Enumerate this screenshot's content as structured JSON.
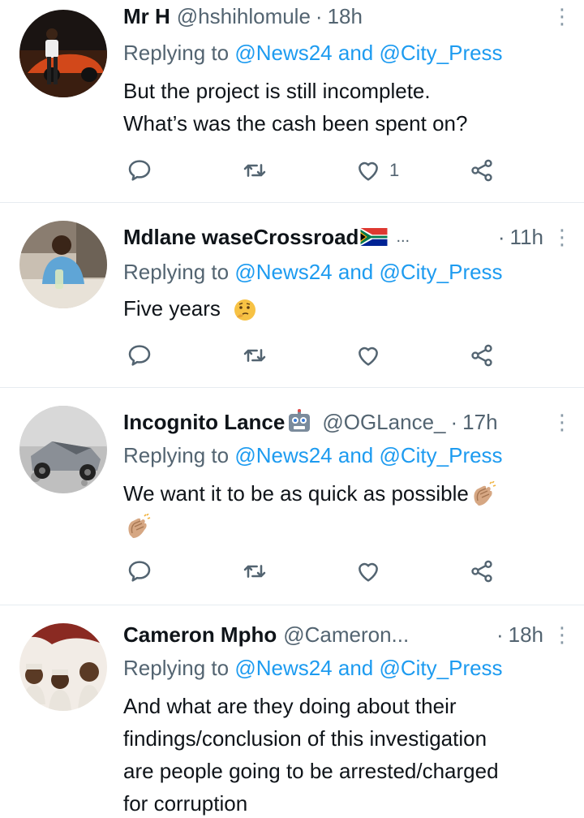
{
  "tweets": [
    {
      "name": "Mr H",
      "handle": "@hshihlomule",
      "time": "18h",
      "reply_prefix": "Replying to ",
      "reply_to_1": "@News24",
      "reply_and": " and ",
      "reply_to_2": "@City_Press",
      "lines": [
        "But the project is still incomplete.",
        "What’s was the cash been spent on?"
      ],
      "like_count": "1"
    },
    {
      "name": "Mdlane waseCrossroad",
      "ellipsis": "...",
      "time": "11h",
      "reply_prefix": "Replying to ",
      "reply_to_1": "@News24",
      "reply_and": " and ",
      "reply_to_2": "@City_Press",
      "lines": [
        "Five years"
      ],
      "emoji": "thinking-face"
    },
    {
      "name": "Incognito Lance",
      "handle": "@OGLance_",
      "time": "17h",
      "reply_prefix": "Replying to ",
      "reply_to_1": "@News24",
      "reply_and": " and ",
      "reply_to_2": "@City_Press",
      "lines": [
        "We want it to be as quick as possible"
      ],
      "emoji": "clapping-hands"
    },
    {
      "name": "Cameron Mpho",
      "handle": "@Cameron...",
      "time": "18h",
      "reply_prefix": "Replying to ",
      "reply_to_1": "@News24",
      "reply_and": " and ",
      "reply_to_2": "@City_Press",
      "lines": [
        "And what are they doing about their",
        "findings/conclusion of this investigation",
        "are people going to be arrested/charged",
        "for corruption"
      ]
    }
  ],
  "colors": {
    "link": "#1d9bf0",
    "secondary": "#536471",
    "text": "#0f1419",
    "divider": "#e6ecf0"
  },
  "icons": {
    "reply": "reply-icon",
    "retweet": "retweet-icon",
    "like": "heart-icon",
    "share": "share-icon",
    "more": "more-vertical-icon"
  }
}
